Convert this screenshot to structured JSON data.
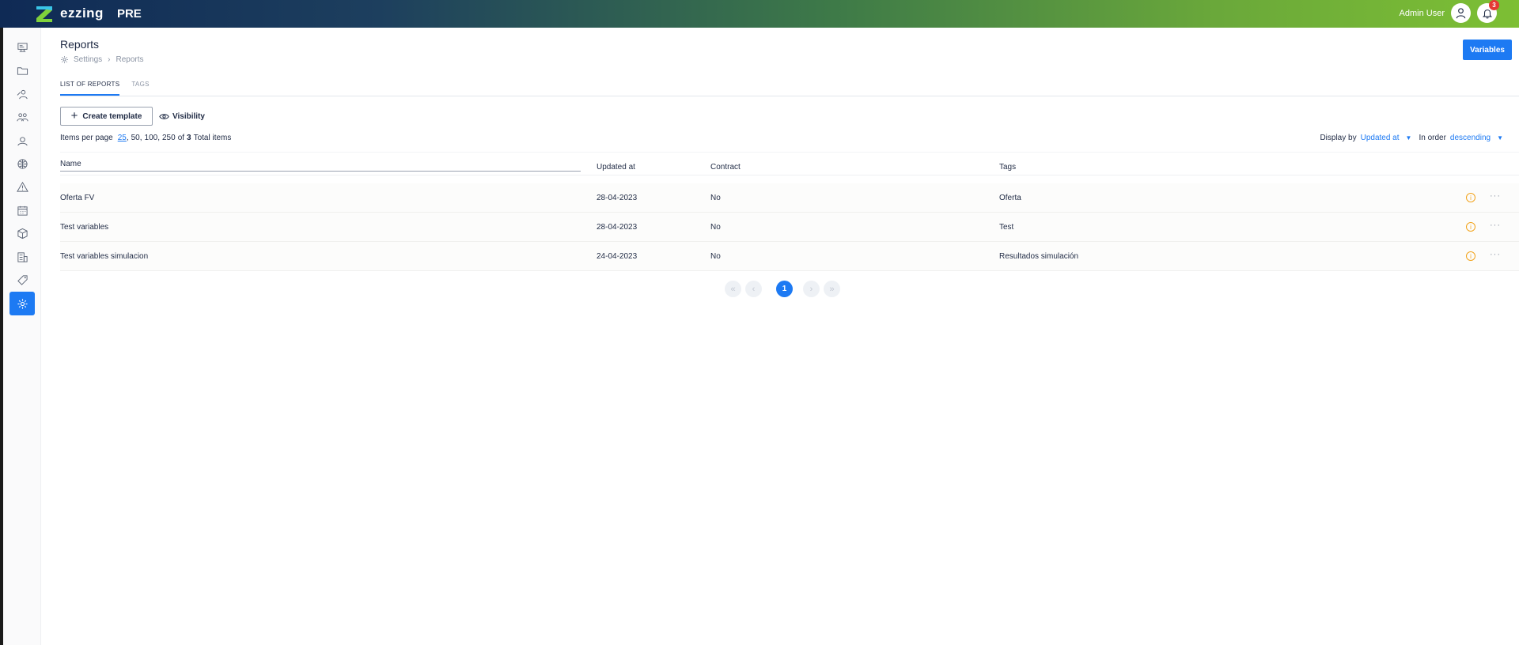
{
  "app": {
    "brand": "ezzing",
    "env": "PRE",
    "user_name": "Admin User",
    "notifications": "3"
  },
  "sidebar": {
    "items": [
      {
        "name": "dashboard-icon"
      },
      {
        "name": "folder-icon"
      },
      {
        "name": "users-icon"
      },
      {
        "name": "team-icon"
      },
      {
        "name": "clients-icon"
      },
      {
        "name": "globe-icon"
      },
      {
        "name": "alert-icon"
      },
      {
        "name": "calendar-icon"
      },
      {
        "name": "box-icon"
      },
      {
        "name": "building-icon"
      },
      {
        "name": "tag-icon"
      },
      {
        "name": "settings-icon",
        "active": true
      }
    ]
  },
  "page": {
    "title": "Reports",
    "breadcrumb": {
      "parent": "Settings",
      "current": "Reports"
    },
    "variables_label": "Variables"
  },
  "tabs": [
    {
      "label": "LIST OF REPORTS",
      "active": true
    },
    {
      "label": "TAGS",
      "active": false
    }
  ],
  "toolbar": {
    "create_label": "Create template",
    "visibility_label": "Visibility"
  },
  "pagination_info": {
    "items_per_page_label": "Items per page",
    "options": [
      "25",
      "50,",
      "100,",
      "250"
    ],
    "selected": "25",
    "of_label": "of",
    "total": "3",
    "total_label": "Total items"
  },
  "sort": {
    "display_by_label": "Display by",
    "display_by_value": "Updated at",
    "order_label": "In order",
    "order_value": "descending"
  },
  "table": {
    "columns": [
      "Name",
      "Updated at",
      "Contract",
      "Tags"
    ],
    "rows": [
      {
        "name": "Oferta FV",
        "updated_at": "28-04-2023",
        "contract": "No",
        "tags": "Oferta"
      },
      {
        "name": "Test variables",
        "updated_at": "28-04-2023",
        "contract": "No",
        "tags": "Test"
      },
      {
        "name": "Test variables simulacion",
        "updated_at": "24-04-2023",
        "contract": "No",
        "tags": "Resultados simulación"
      }
    ],
    "row_actions": {
      "info_icon": "i",
      "more_icon": "···"
    }
  },
  "pager": {
    "current": "1"
  },
  "colors": {
    "accent": "#1d7af3",
    "warning": "#f2a31b",
    "badge": "#e53935"
  }
}
